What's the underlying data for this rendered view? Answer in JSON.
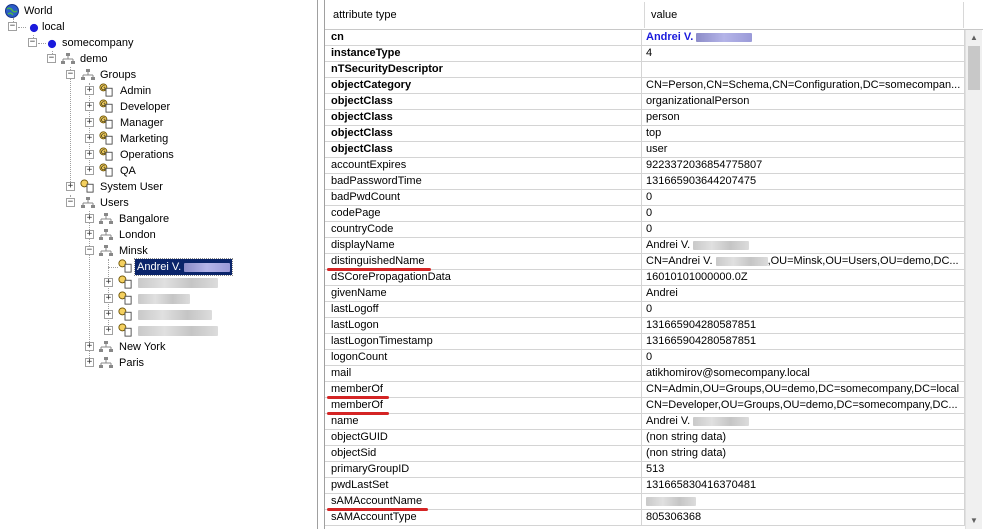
{
  "tree": {
    "world": "World",
    "local": "local",
    "somecompany": "somecompany",
    "demo": "demo",
    "groups": "Groups",
    "group_items": [
      "Admin",
      "Developer",
      "Manager",
      "Marketing",
      "Operations",
      "QA"
    ],
    "system_user": "System User",
    "users": "Users",
    "user_ous": [
      "Bangalore",
      "London",
      "Minsk"
    ],
    "selected_user": "Andrei V.",
    "other_ous": [
      "New York",
      "Paris"
    ]
  },
  "grid": {
    "header": {
      "attribute": "attribute type",
      "value": "value"
    },
    "rows": [
      {
        "attr": "cn",
        "value": "Andrei V.",
        "style": "bold-blue",
        "redacted": true
      },
      {
        "attr": "instanceType",
        "value": "4",
        "style": "bold"
      },
      {
        "attr": "nTSecurityDescriptor",
        "value": "",
        "style": "bold"
      },
      {
        "attr": "objectCategory",
        "value": "CN=Person,CN=Schema,CN=Configuration,DC=somecompan...",
        "style": "bold"
      },
      {
        "attr": "objectClass",
        "value": "organizationalPerson",
        "style": "bold"
      },
      {
        "attr": "objectClass",
        "value": "person",
        "style": "bold"
      },
      {
        "attr": "objectClass",
        "value": "top",
        "style": "bold"
      },
      {
        "attr": "objectClass",
        "value": "user",
        "style": "bold"
      },
      {
        "attr": "accountExpires",
        "value": "9223372036854775807"
      },
      {
        "attr": "badPasswordTime",
        "value": "131665903644207475"
      },
      {
        "attr": "badPwdCount",
        "value": "0"
      },
      {
        "attr": "codePage",
        "value": "0"
      },
      {
        "attr": "countryCode",
        "value": "0"
      },
      {
        "attr": "displayName",
        "value": "Andrei V.",
        "redacted": true
      },
      {
        "attr": "distinguishedName",
        "value": "CN=Andrei V.",
        "value_tail": ",OU=Minsk,OU=Users,OU=demo,DC...",
        "redacted": true,
        "underline": true
      },
      {
        "attr": "dSCorePropagationData",
        "value": "16010101000000.0Z"
      },
      {
        "attr": "givenName",
        "value": "Andrei"
      },
      {
        "attr": "lastLogoff",
        "value": "0"
      },
      {
        "attr": "lastLogon",
        "value": "131665904280587851"
      },
      {
        "attr": "lastLogonTimestamp",
        "value": "131665904280587851"
      },
      {
        "attr": "logonCount",
        "value": "0"
      },
      {
        "attr": "mail",
        "value": "atikhomirov@somecompany.local"
      },
      {
        "attr": "memberOf",
        "value": "CN=Admin,OU=Groups,OU=demo,DC=somecompany,DC=local",
        "underline": true
      },
      {
        "attr": "memberOf",
        "value": "CN=Developer,OU=Groups,OU=demo,DC=somecompany,DC...",
        "underline": true
      },
      {
        "attr": "name",
        "value": "Andrei V.",
        "redacted": true
      },
      {
        "attr": "objectGUID",
        "value": "(non string data)"
      },
      {
        "attr": "objectSid",
        "value": "(non string data)"
      },
      {
        "attr": "primaryGroupID",
        "value": "513"
      },
      {
        "attr": "pwdLastSet",
        "value": "131665830416370481"
      },
      {
        "attr": "sAMAccountName",
        "value": "",
        "redacted": true,
        "underline": true
      },
      {
        "attr": "sAMAccountType",
        "value": "805306368"
      }
    ]
  },
  "colors": {
    "selection": "#0a246a",
    "annotation": "#d42424",
    "cn_value": "#1a1adc"
  }
}
